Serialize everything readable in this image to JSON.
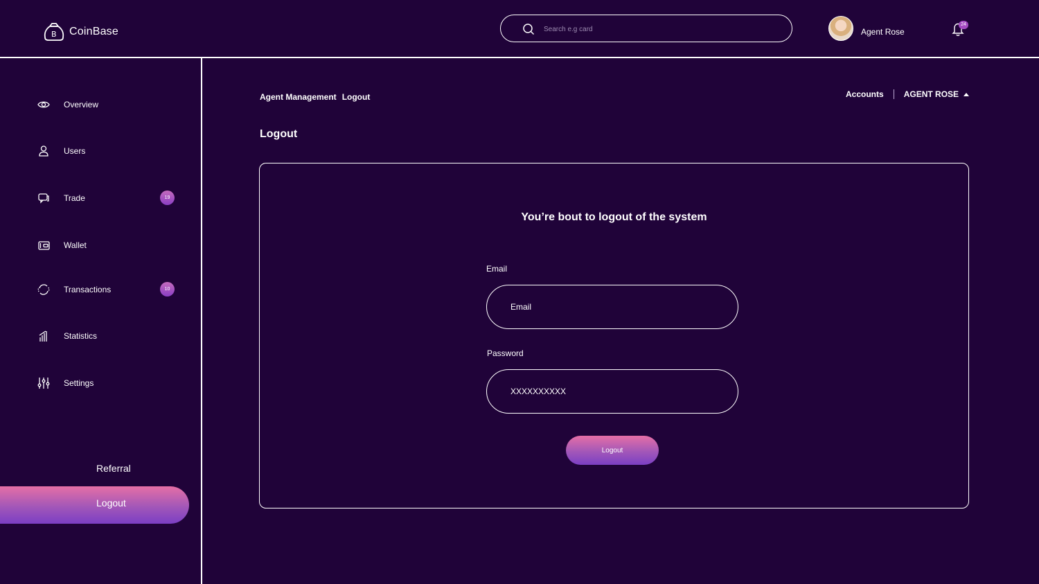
{
  "brand": {
    "name": "CoinBase",
    "icon": "bitcoin-bag-icon"
  },
  "header": {
    "search_placeholder": "Search e.g card",
    "user_name": "Agent Rose",
    "notification_count": "24"
  },
  "sidebar": {
    "items": [
      {
        "label": "Overview",
        "icon": "eye-icon"
      },
      {
        "label": "Users",
        "icon": "user-icon"
      },
      {
        "label": "Trade",
        "icon": "chat-icon",
        "badge": "19"
      },
      {
        "label": "Wallet",
        "icon": "wallet-icon"
      },
      {
        "label": "Transactions",
        "icon": "refresh-icon",
        "badge": "10"
      },
      {
        "label": "Statistics",
        "icon": "bars-icon"
      },
      {
        "label": "Settings",
        "icon": "sliders-icon"
      }
    ],
    "referral": "Referral",
    "logout": "Logout"
  },
  "breadcrumb": {
    "section": "Agent Management",
    "current": "Logout"
  },
  "top_right": {
    "accounts": "Accounts",
    "agent": "AGENT ROSE"
  },
  "page_title": "Logout",
  "form": {
    "heading": "You’re bout to logout of the system",
    "email_label": "Email",
    "email_placeholder": "Email",
    "password_label": "Password",
    "password_value": "XXXXXXXXXX",
    "submit": "Logout"
  },
  "colors": {
    "background": "#200339",
    "accent_start": "#e56fa6",
    "accent_end": "#7b3fc4",
    "border": "#ffffff"
  }
}
